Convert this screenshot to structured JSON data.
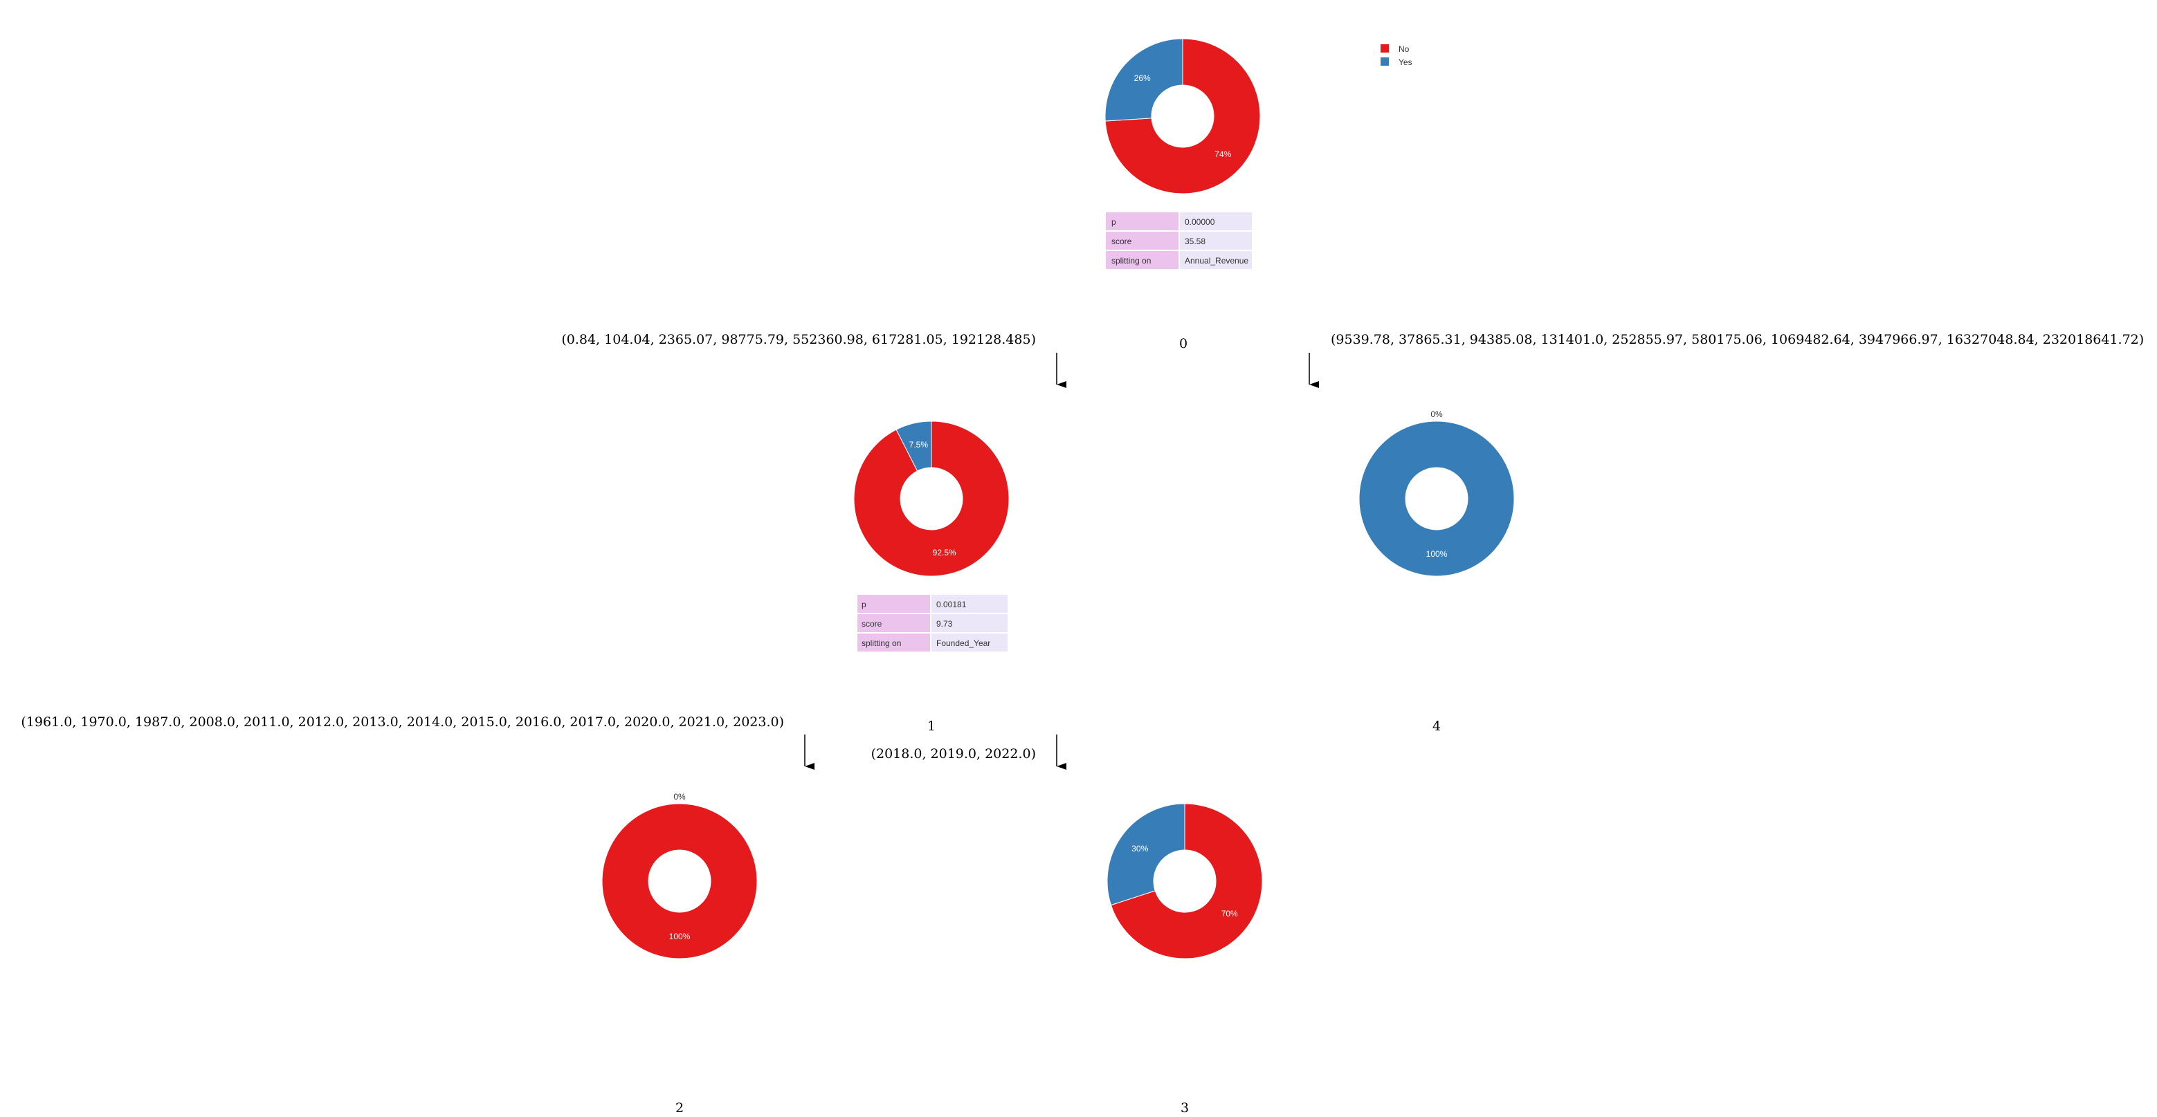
{
  "legend": [
    {
      "label": "No",
      "color": "#e41a1c"
    },
    {
      "label": "Yes",
      "color": "#377eb8"
    }
  ],
  "nodes": [
    {
      "id": "0",
      "label": "0",
      "slices": [
        {
          "class": "No",
          "percent": 74,
          "label": "74%"
        },
        {
          "class": "Yes",
          "percent": 26,
          "label": "26%"
        }
      ],
      "stats": [
        {
          "key": "p",
          "value": "0.00000"
        },
        {
          "key": "score",
          "value": "35.58"
        },
        {
          "key": "splitting on",
          "value": "Annual_Revenue"
        }
      ]
    },
    {
      "id": "1",
      "label": "1",
      "slices": [
        {
          "class": "No",
          "percent": 92.5,
          "label": "92.5%"
        },
        {
          "class": "Yes",
          "percent": 7.5,
          "label": "7.5%"
        }
      ],
      "stats": [
        {
          "key": "p",
          "value": "0.00181"
        },
        {
          "key": "score",
          "value": "9.73"
        },
        {
          "key": "splitting on",
          "value": "Founded_Year"
        }
      ]
    },
    {
      "id": "4",
      "label": "4",
      "slices": [
        {
          "class": "No",
          "percent": 0,
          "label": "0%"
        },
        {
          "class": "Yes",
          "percent": 100,
          "label": "100%"
        }
      ],
      "stats": []
    },
    {
      "id": "2",
      "label": "2",
      "slices": [
        {
          "class": "No",
          "percent": 100,
          "label": "100%"
        },
        {
          "class": "Yes",
          "percent": 0,
          "label": "0%"
        }
      ],
      "stats": []
    },
    {
      "id": "3",
      "label": "3",
      "slices": [
        {
          "class": "No",
          "percent": 70,
          "label": "70%"
        },
        {
          "class": "Yes",
          "percent": 30,
          "label": "30%"
        }
      ],
      "stats": []
    }
  ],
  "edges": [
    {
      "from": "0",
      "to": "1",
      "label": "(0.84, 104.04, 2365.07, 98775.79, 552360.98, 617281.05, 192128.485)"
    },
    {
      "from": "0",
      "to": "4",
      "label": "(9539.78, 37865.31, 94385.08, 131401.0, 252855.97, 580175.06, 1069482.64, 3947966.97, 16327048.84, 232018641.72)"
    },
    {
      "from": "1",
      "to": "2",
      "label": "(1961.0, 1970.0, 1987.0, 2008.0, 2011.0, 2012.0, 2013.0, 2014.0, 2015.0, 2016.0, 2017.0, 2020.0, 2021.0, 2023.0)"
    },
    {
      "from": "1",
      "to": "3",
      "label": "(2018.0, 2019.0, 2022.0)"
    }
  ],
  "table_colors": {
    "key_bg": "#ebc3ec",
    "value_bg": "#ebe7f8"
  }
}
